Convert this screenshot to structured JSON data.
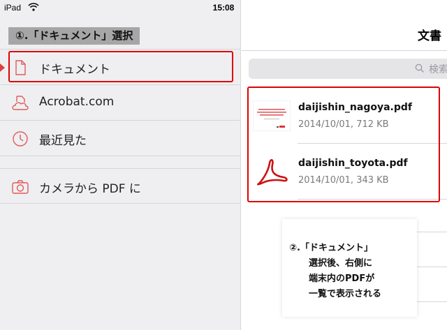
{
  "statusbar": {
    "device": "iPad",
    "time": "15:08"
  },
  "sidebar": {
    "ghost_header": " ",
    "annotation": "①.「ドキュメント」選択",
    "items": [
      {
        "label": "ドキュメント",
        "icon": "document-icon"
      },
      {
        "label": "Acrobat.com",
        "icon": "cloud-document-icon"
      },
      {
        "label": "最近見た",
        "icon": "clock-icon"
      },
      {
        "label": "カメラから PDF に",
        "icon": "camera-icon"
      }
    ]
  },
  "main": {
    "title": "文書",
    "search_placeholder": "検索",
    "files": [
      {
        "name": "daijishin_nagoya.pdf",
        "meta": "2014/10/01, 712 KB",
        "thumb": "page-thumbnail"
      },
      {
        "name": "daijishin_toyota.pdf",
        "meta": "2014/10/01, 343 KB",
        "thumb": "acrobat-pdf-icon"
      }
    ]
  },
  "annotation2": {
    "line1": "②.「ドキュメント」",
    "line2": "選択後、右側に",
    "line3": "端末内のPDFが",
    "line4": "一覧で表示される"
  },
  "colors": {
    "accent": "#e04040",
    "highlight": "#e00000",
    "sidebar_bg": "#efeff1"
  }
}
